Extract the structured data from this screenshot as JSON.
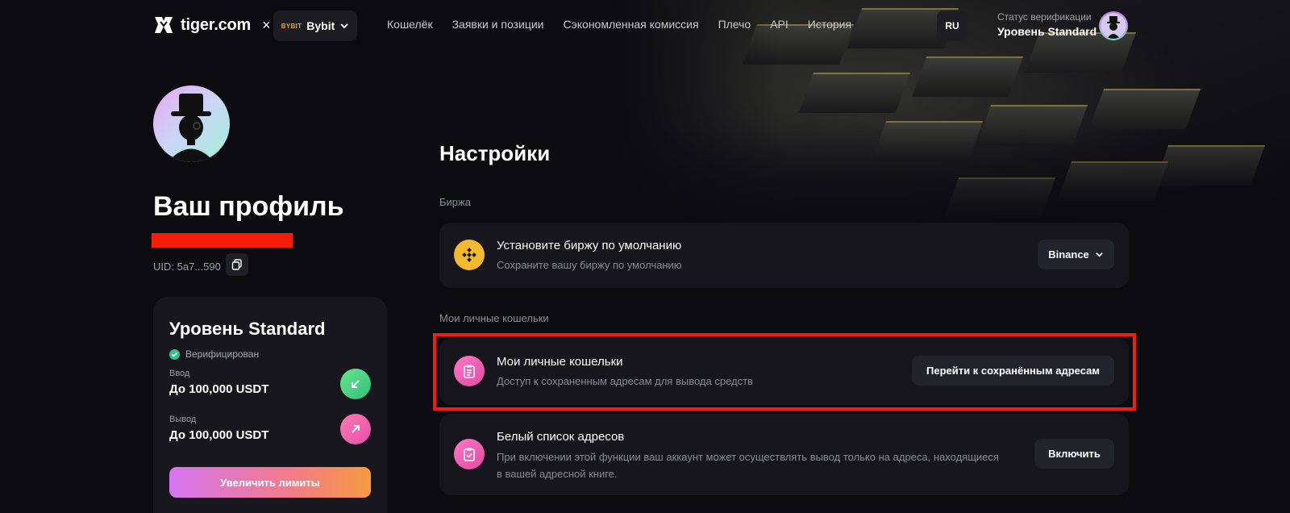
{
  "header": {
    "logo_text": "tiger.com",
    "logo_sep": "×",
    "exchange_mini": "BYBIT",
    "exchange_name": "Bybit",
    "nav": [
      "Кошелёк",
      "Заявки и позиции",
      "Сэкономленная комиссия",
      "Плечо",
      "API",
      "История"
    ],
    "lang": "RU",
    "verification_label": "Статус верификации",
    "verification_value": "Уровень Standard"
  },
  "profile": {
    "title": "Ваш профиль",
    "uid": "UID: 5a7...590"
  },
  "level_card": {
    "title": "Уровень Standard",
    "status": "Верифицирован",
    "deposit_label": "Ввод",
    "deposit_value": "До 100,000 USDT",
    "withdraw_label": "Вывод",
    "withdraw_value": "До 100,000 USDT",
    "increase_button": "Увеличить лимиты"
  },
  "settings": {
    "title": "Настройки",
    "exchange_section": "Биржа",
    "default_exchange": {
      "title": "Установите биржу по умолчанию",
      "subtitle": "Сохраните вашу биржу по умолчанию",
      "button": "Binance"
    },
    "wallets_section": "Мои личные кошельки",
    "wallets": {
      "title": "Мои личные кошельки",
      "subtitle": "Доступ к сохраненным адресам для вывода средств",
      "button": "Перейти к сохранённым адресам"
    },
    "whitelist": {
      "title": "Белый список адресов",
      "subtitle_line1": "При включении этой функции ваш аккаунт может осуществлять вывод только на адреса, находящиеся",
      "subtitle_line2": "в вашей адресной книге.",
      "button": "Включить"
    }
  },
  "colors": {
    "highlight": "#f41d08",
    "binance": "#f3ba2f",
    "accent_pink": "#e348a0",
    "verified_green": "#35c28c"
  }
}
